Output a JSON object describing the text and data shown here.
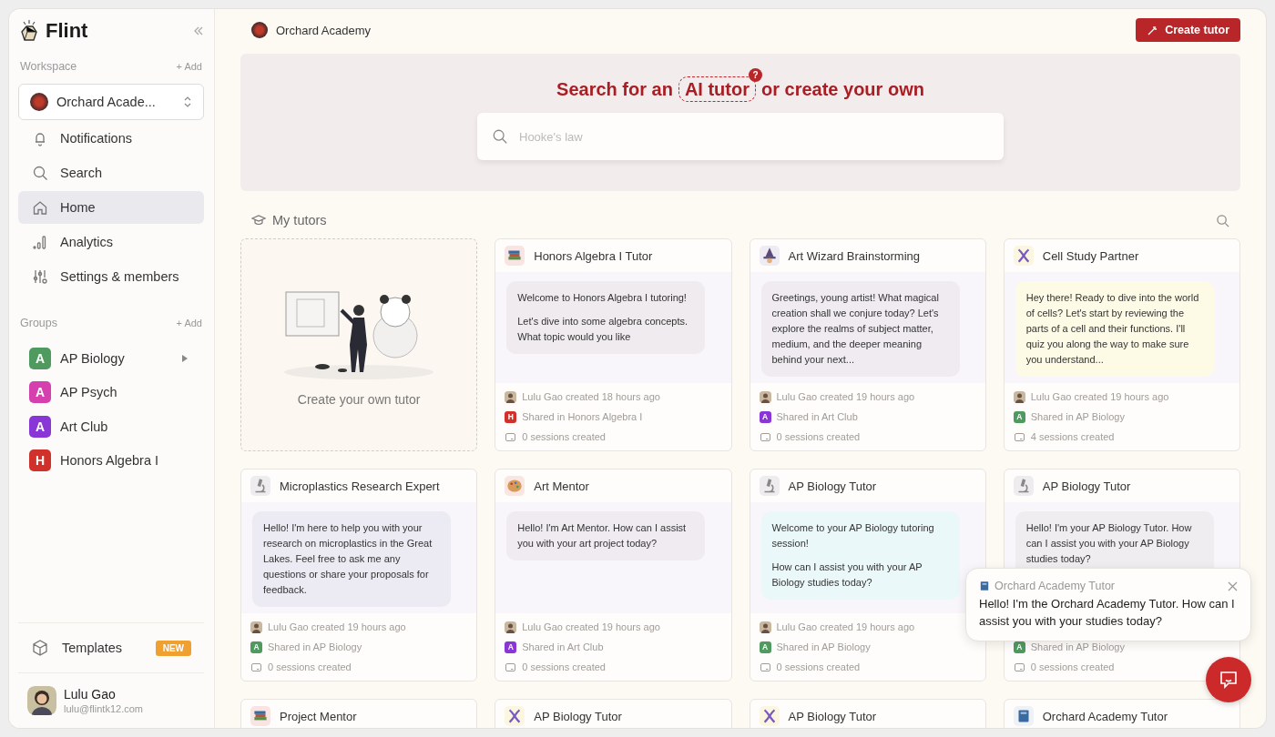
{
  "sidebar": {
    "brand": "Flint",
    "workspace_label": "Workspace",
    "workspace_add": "+ Add",
    "workspace": "Orchard Acade...",
    "nav": [
      {
        "label": "Notifications",
        "kind": "bell",
        "selected": false
      },
      {
        "label": "Search",
        "kind": "search",
        "selected": false
      },
      {
        "label": "Home",
        "kind": "home",
        "selected": true
      },
      {
        "label": "Analytics",
        "kind": "chart",
        "selected": false
      },
      {
        "label": "Settings & members",
        "kind": "sliders",
        "selected": false
      }
    ],
    "groups_label": "Groups",
    "groups_add": "+ Add",
    "groups": [
      {
        "letter": "A",
        "label": "AP Biology",
        "color": "#4f9a5f",
        "expandable": true
      },
      {
        "letter": "A",
        "label": "AP Psych",
        "color": "#d63fae",
        "expandable": false
      },
      {
        "letter": "A",
        "label": "Art Club",
        "color": "#8a35d6",
        "expandable": false
      },
      {
        "letter": "H",
        "label": "Honors Algebra I",
        "color": "#d0322b",
        "expandable": false
      }
    ],
    "templates": {
      "label": "Templates",
      "badge": "NEW"
    },
    "user": {
      "name": "Lulu Gao",
      "email": "lulu@flintk12.com"
    }
  },
  "topbar": {
    "org": "Orchard Academy",
    "create_button": "Create tutor"
  },
  "hero": {
    "before": "Search for an",
    "highlight": "AI tutor",
    "help": "?",
    "after": "or create your own",
    "placeholder": "Hooke's law"
  },
  "section": {
    "title": "My tutors"
  },
  "create_card": {
    "label": "Create your own tutor"
  },
  "cards": [
    {
      "title": "Honors Algebra I Tutor",
      "kind": "books",
      "message": [
        "Welcome to Honors Algebra I tutoring!",
        "Let's dive into some algebra concepts. What topic would you like"
      ],
      "color": "#efebee",
      "creator": "Lulu Gao created 18 hours ago",
      "group": {
        "letter": "H",
        "label": "Shared in Honors Algebra I",
        "color": "#d0322b"
      },
      "sessions": "0 sessions created"
    },
    {
      "title": "Art Wizard Brainstorming",
      "kind": "wizard",
      "message": [
        "Greetings, young artist! What magical creation shall we conjure today? Let's explore the realms of subject matter, medium, and the deeper meaning behind your next..."
      ],
      "color": "#efebf1",
      "creator": "Lulu Gao created 19 hours ago",
      "group": {
        "letter": "A",
        "label": "Shared in Art Club",
        "color": "#8a35d6"
      },
      "sessions": "0 sessions created"
    },
    {
      "title": "Cell Study Partner",
      "kind": "dna",
      "message": [
        "Hey there! Ready to dive into the world of cells? Let's start by reviewing the parts of a cell and their functions. I'll quiz you along the way to make sure you understand..."
      ],
      "color": "#fdfbe6",
      "creator": "Lulu Gao created 19 hours ago",
      "group": {
        "letter": "A",
        "label": "Shared in AP Biology",
        "color": "#4f9a5f"
      },
      "sessions": "4 sessions created"
    },
    {
      "title": "Microplastics Research Expert",
      "kind": "microscope",
      "message": [
        "Hello! I'm here to help you with your research on microplastics in the Great Lakes. Feel free to ask me any questions or share your proposals for feedback."
      ],
      "color": "#eceaf3",
      "creator": "Lulu Gao created 19 hours ago",
      "group": {
        "letter": "A",
        "label": "Shared in AP Biology",
        "color": "#4f9a5f"
      },
      "sessions": "0 sessions created"
    },
    {
      "title": "Art Mentor",
      "kind": "palette",
      "message": [
        "Hello! I'm Art Mentor. How can I assist you with your art project today?"
      ],
      "color": "#efebf1",
      "creator": "Lulu Gao created 19 hours ago",
      "group": {
        "letter": "A",
        "label": "Shared in Art Club",
        "color": "#8a35d6"
      },
      "sessions": "0 sessions created"
    },
    {
      "title": "AP Biology Tutor",
      "kind": "microscope",
      "message": [
        "Welcome to your AP Biology tutoring session!",
        "How can I assist you with your AP Biology studies today?"
      ],
      "color": "#ebf8fa",
      "creator": "Lulu Gao created 19 hours ago",
      "group": {
        "letter": "A",
        "label": "Shared in AP Biology",
        "color": "#4f9a5f"
      },
      "sessions": "0 sessions created"
    },
    {
      "title": "AP Biology Tutor",
      "kind": "microscope",
      "message": [
        "Hello! I'm your AP Biology Tutor. How can I assist you with your AP Biology studies today?"
      ],
      "color": "#efedf0",
      "group": {
        "letter": "A",
        "label": "Shared in AP Biology",
        "color": "#4f9a5f"
      },
      "sessions": "0 sessions created"
    },
    {
      "title": "Project Mentor",
      "kind": "books"
    },
    {
      "title": "AP Biology Tutor",
      "kind": "dna"
    },
    {
      "title": "AP Biology Tutor",
      "kind": "dna"
    },
    {
      "title": "Orchard Academy Tutor",
      "kind": "book"
    }
  ],
  "chat_popup": {
    "title": "Orchard Academy Tutor",
    "message": "Hello! I'm the Orchard Academy Tutor. How can I assist you with your studies today?"
  }
}
